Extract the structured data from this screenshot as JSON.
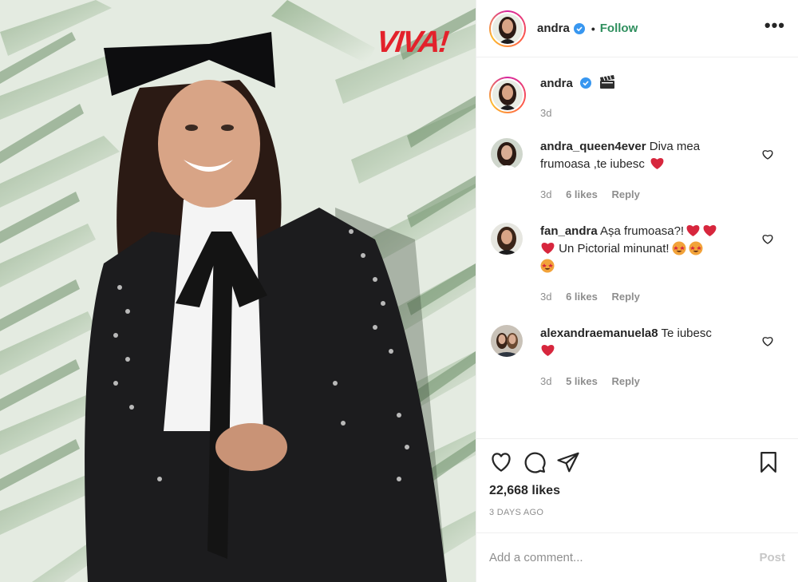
{
  "photo": {
    "alt": "Photo by andra",
    "magazine_logo": "VIVA!"
  },
  "header": {
    "username": "andra",
    "separator": "•",
    "follow_label": "Follow",
    "more_label": "•••"
  },
  "caption": {
    "username": "andra",
    "emoji": "clapper-board",
    "time": "3d"
  },
  "comments": [
    {
      "username": "andra_queen4ever",
      "text": "Diva mea frumoasa ,te iubesc",
      "time": "3d",
      "likes": "6 likes",
      "reply": "Reply"
    },
    {
      "username": "fan_andra",
      "text": "Așa frumoasa?!",
      "text2": "Un Pictorial minunat!",
      "time": "3d",
      "likes": "6 likes",
      "reply": "Reply"
    },
    {
      "username": "alexandraemanuela8",
      "text": "Te iubesc",
      "time": "3d",
      "likes": "5 likes",
      "reply": "Reply"
    }
  ],
  "actions": {
    "likes": "22,668 likes",
    "ago": "3 DAYS AGO"
  },
  "add_comment": {
    "placeholder": "Add a comment...",
    "post_label": "Post"
  },
  "colors": {
    "verified": "#3897f0",
    "heart": "#ed4956",
    "viva_red": "#e3222b",
    "leaf_green": "#7fa07a"
  }
}
